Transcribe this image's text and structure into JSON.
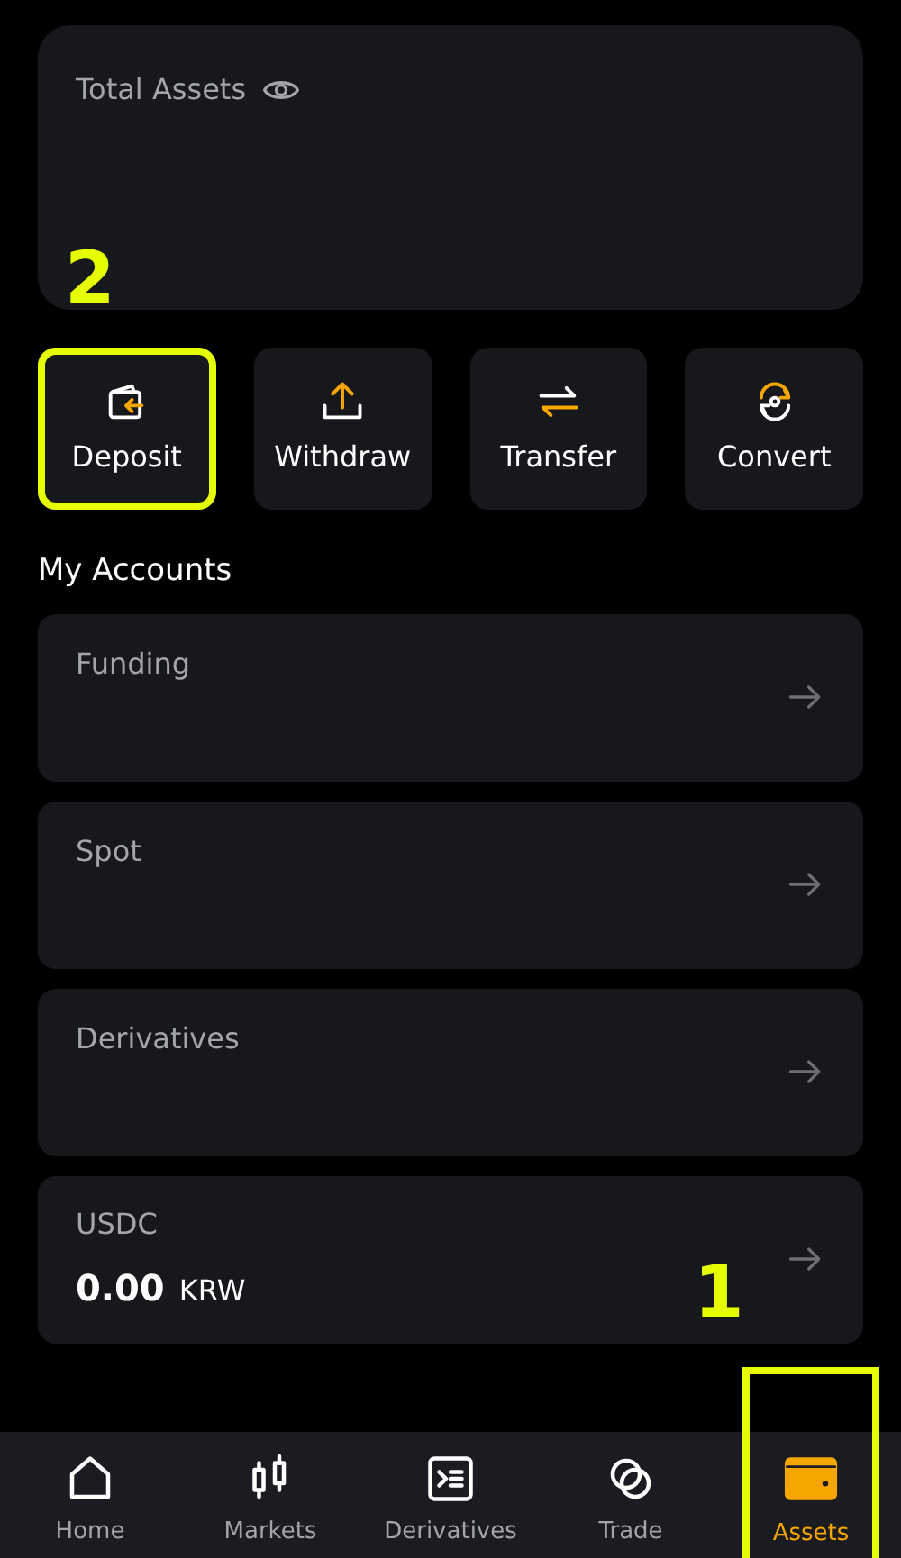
{
  "total_assets": {
    "label": "Total Assets"
  },
  "actions": [
    {
      "label": "Deposit",
      "kind": "deposit",
      "highlighted": true,
      "annotation": "2"
    },
    {
      "label": "Withdraw",
      "kind": "withdraw",
      "highlighted": false
    },
    {
      "label": "Transfer",
      "kind": "transfer",
      "highlighted": false
    },
    {
      "label": "Convert",
      "kind": "convert",
      "highlighted": false
    }
  ],
  "accounts_title": "My Accounts",
  "accounts": [
    {
      "name": "Funding"
    },
    {
      "name": "Spot"
    },
    {
      "name": "Derivatives"
    },
    {
      "name": "USDC",
      "amount": "0.00",
      "currency": "KRW"
    }
  ],
  "bottom_nav": [
    {
      "label": "Home",
      "kind": "home",
      "selected": false,
      "highlighted": false
    },
    {
      "label": "Markets",
      "kind": "markets",
      "selected": false,
      "highlighted": false
    },
    {
      "label": "Derivatives",
      "kind": "derivatives",
      "selected": false,
      "highlighted": false
    },
    {
      "label": "Trade",
      "kind": "trade",
      "selected": false,
      "highlighted": false
    },
    {
      "label": "Assets",
      "kind": "assets",
      "selected": true,
      "highlighted": true,
      "annotation": "1"
    }
  ]
}
